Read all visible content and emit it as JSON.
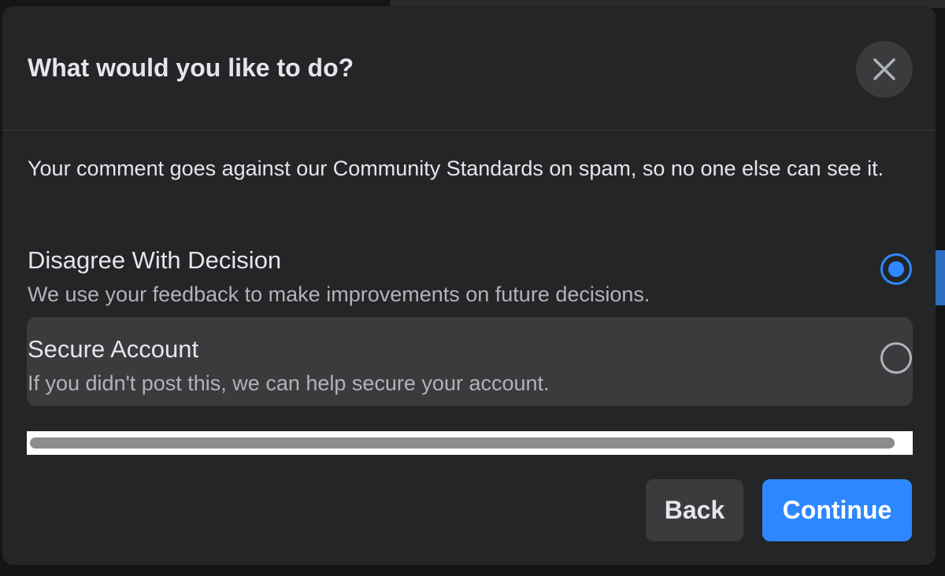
{
  "dialog": {
    "title": "What would you like to do?",
    "message": "Your comment goes against our Community Standards on spam, so no one else can see it."
  },
  "options": [
    {
      "title": "Disagree With Decision",
      "description": "We use your feedback to make improvements on future decisions.",
      "selected": true
    },
    {
      "title": "Secure Account",
      "description": "If you didn't post this, we can help secure your account.",
      "selected": false
    }
  ],
  "buttons": {
    "back": "Back",
    "continue": "Continue"
  },
  "icons": {
    "close": "close-icon"
  },
  "colors": {
    "accent": "#2d88ff",
    "modal_bg": "#242526",
    "selected_option_bg": "#3a3b3c",
    "primary_text": "#e4e6eb",
    "secondary_text": "#b0b3b8"
  }
}
